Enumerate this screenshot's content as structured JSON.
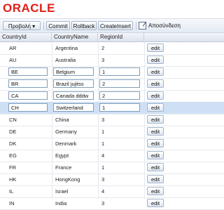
{
  "brand": {
    "logo_text": "ORACLE",
    "logo_color": "#e21e16"
  },
  "toolbar": {
    "view_menu_label": "Προβολή ▾",
    "commit_label": "Commit",
    "rollback_label": "Rollback",
    "create_insert_label": "CreateInsert",
    "disconnect_label": "Αποσύνδεση"
  },
  "table": {
    "columns": [
      "CountryId",
      "CountryName",
      "RegionId",
      ""
    ],
    "edit_label": "edit",
    "rows": [
      {
        "id": "AR",
        "name": "Argentina",
        "region": "2",
        "editing": false
      },
      {
        "id": "AU",
        "name": "Australia",
        "region": "3",
        "editing": false
      },
      {
        "id": "BE",
        "name": "Belgium",
        "region": "1",
        "editing": true
      },
      {
        "id": "BR",
        "name": "Brazil jujitss",
        "region": "2",
        "editing": true
      },
      {
        "id": "CA",
        "name": "Canada dddw",
        "region": "2",
        "editing": true
      },
      {
        "id": "CH",
        "name": "Switzerland",
        "region": "1",
        "editing": true,
        "selected": true
      },
      {
        "id": "CN",
        "name": "China",
        "region": "3",
        "editing": false
      },
      {
        "id": "DE",
        "name": "Germany",
        "region": "1",
        "editing": false
      },
      {
        "id": "DK",
        "name": "Denmark",
        "region": "1",
        "editing": false
      },
      {
        "id": "EG",
        "name": "Egypt",
        "region": "4",
        "editing": false
      },
      {
        "id": "FR",
        "name": "France",
        "region": "1",
        "editing": false
      },
      {
        "id": "HK",
        "name": "HongKong",
        "region": "3",
        "editing": false
      },
      {
        "id": "IL",
        "name": "Israel",
        "region": "4",
        "editing": false
      },
      {
        "id": "IN",
        "name": "India",
        "region": "3",
        "editing": false
      }
    ]
  }
}
